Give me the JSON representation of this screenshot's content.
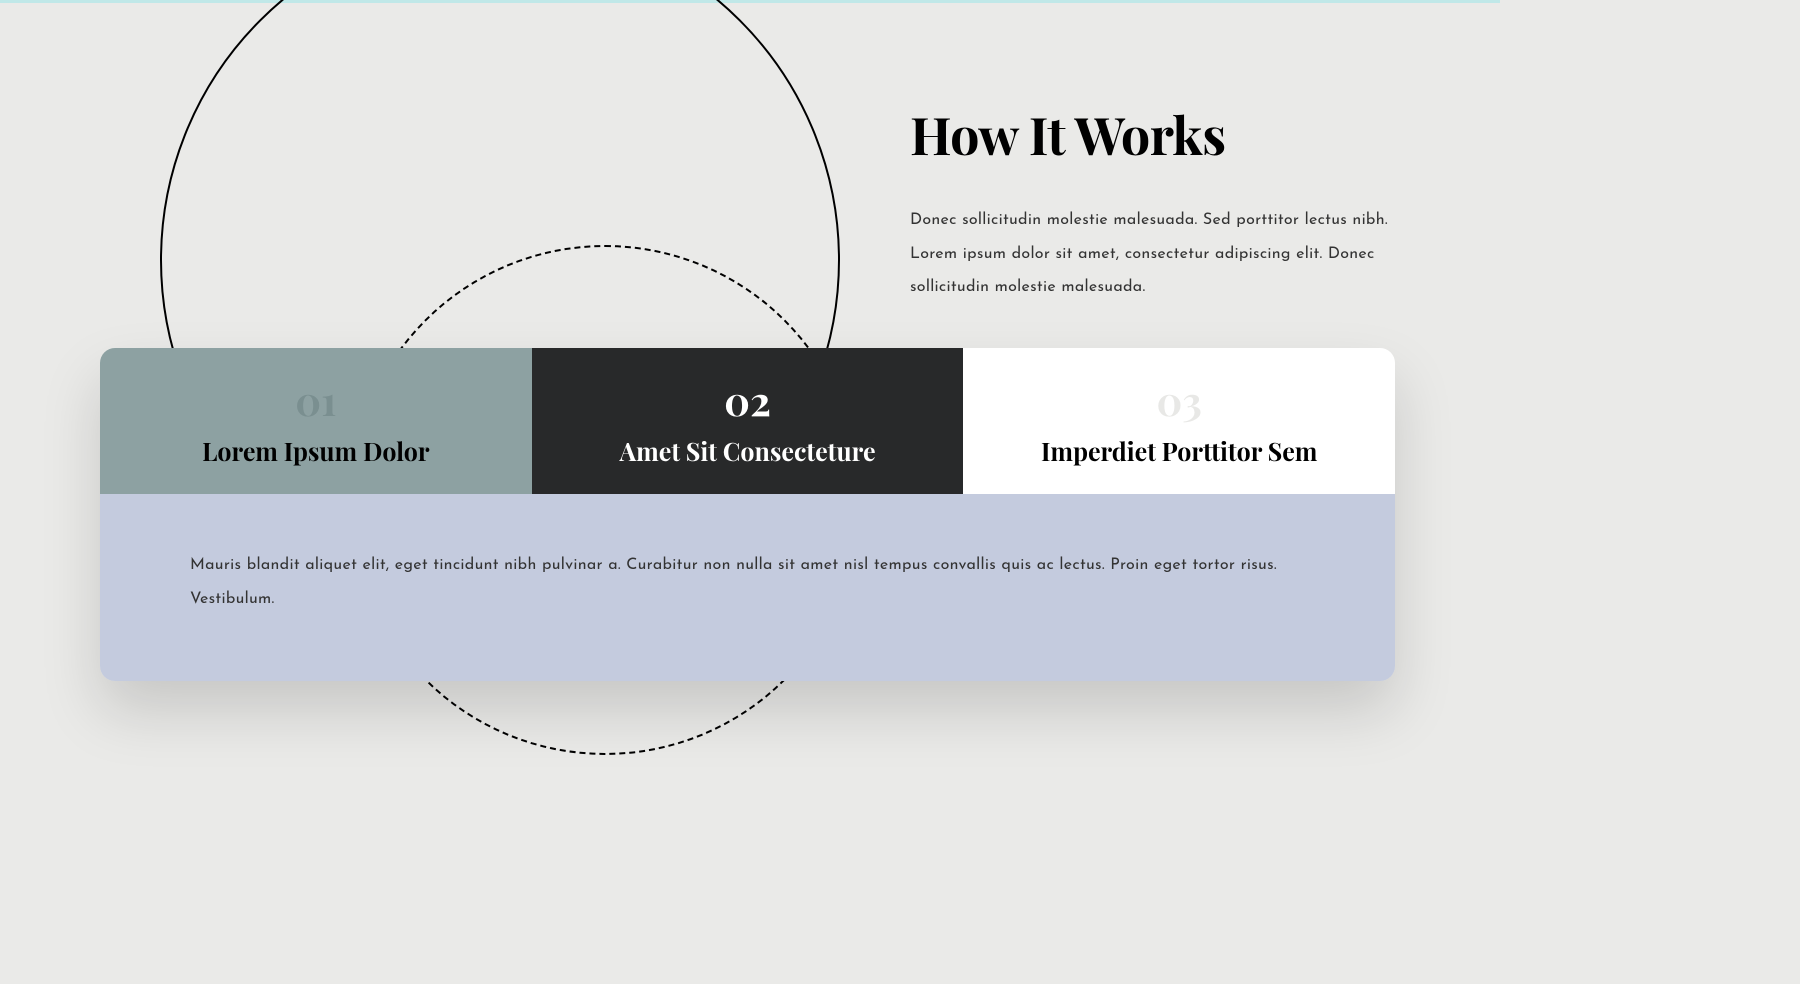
{
  "header": {
    "title": "How It Works",
    "description": "Donec sollicitudin molestie malesuada. Sed porttitor lectus nibh. Lorem ipsum dolor sit amet, consectetur adipiscing elit. Donec sollicitudin molestie malesuada."
  },
  "tabs": [
    {
      "number": "01",
      "title": "Lorem Ipsum Dolor"
    },
    {
      "number": "02",
      "title": "Amet Sit Consecteture"
    },
    {
      "number": "03",
      "title": "Imperdiet Porttitor Sem"
    }
  ],
  "content": {
    "text": "Mauris blandit aliquet elit, eget tincidunt nibh pulvinar a. Curabitur non nulla sit amet nisl tempus convallis quis ac lectus. Proin eget tortor risus. Vestibulum."
  }
}
